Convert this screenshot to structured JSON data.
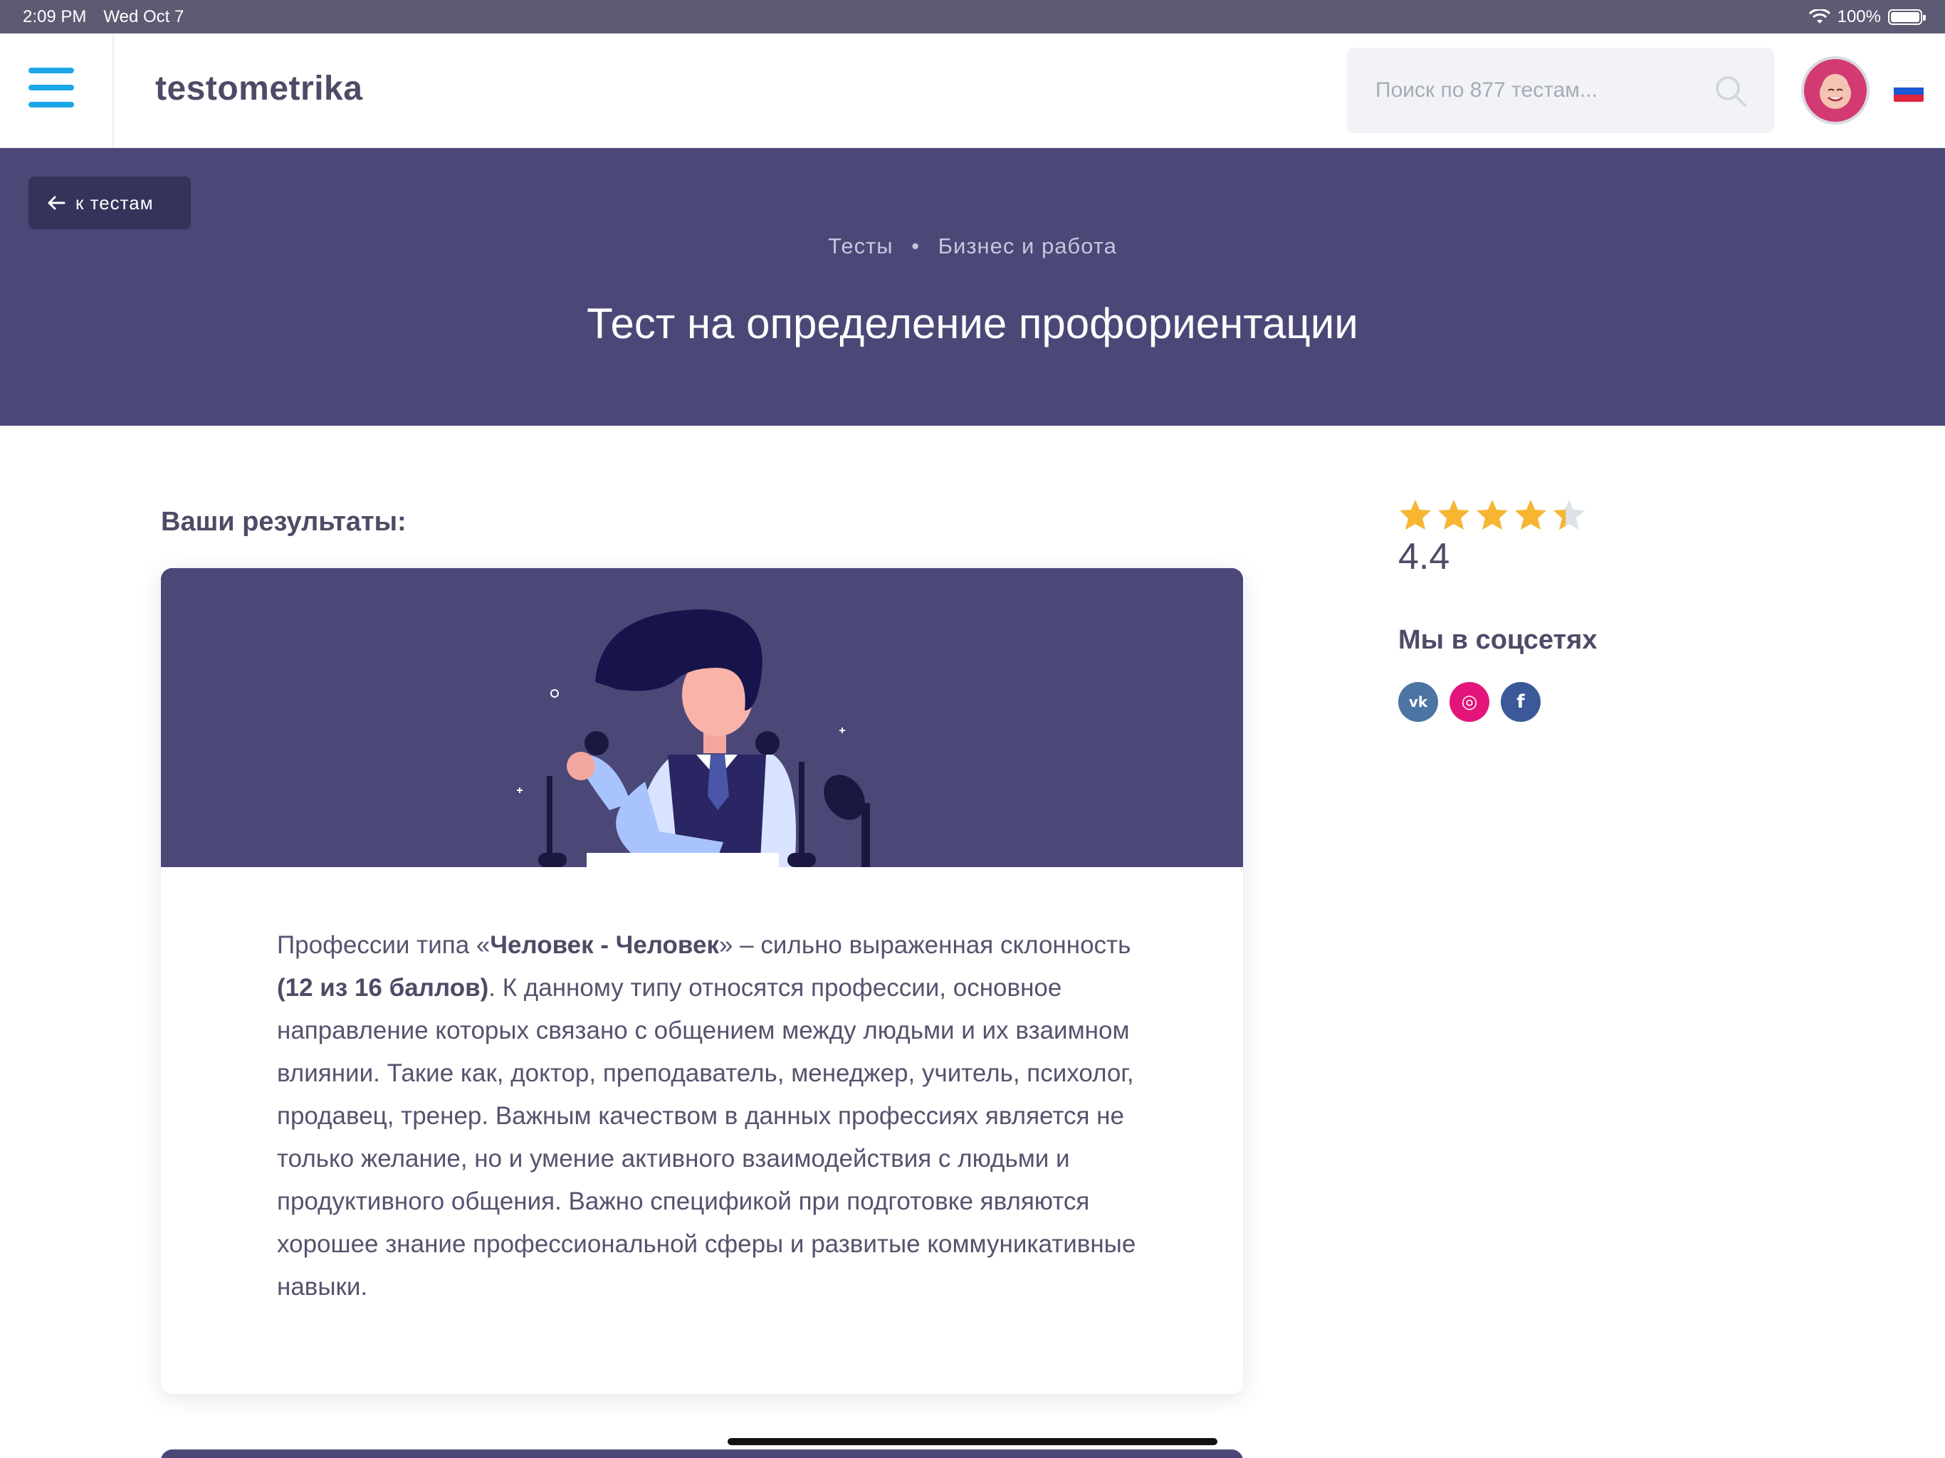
{
  "status_bar": {
    "time": "2:09 PM",
    "date": "Wed Oct 7",
    "battery": "100%"
  },
  "header": {
    "logo": "testometrika",
    "search_placeholder": "Поиск по 877 тестам..."
  },
  "hero": {
    "back_label": "к тестам",
    "breadcrumb": [
      "Тесты",
      "Бизнес и работа"
    ],
    "breadcrumb_separator": "•",
    "title": "Тест на определение профориентации"
  },
  "results": {
    "heading": "Ваши результаты:",
    "text_parts": [
      "Профессии типа «",
      "Человек - Человек",
      "» – сильно выраженная склонность ",
      "(12 из 16 баллов)",
      ". К данному типу относятся профессии, основное направление которых связано с общением между людьми и их взаимном влиянии. Такие как, доктор, преподаватель, менеджер, учитель, психолог, продавец, тренер. Важным качеством в данных профессиях является не только желание, но и умение активного взаимодействия с людьми и продуктивного общения. Важно спецификой при подготовке являются хорошее знание профессиональной сферы и развитые коммуникативные навыки."
    ]
  },
  "sidebar": {
    "rating": "4.4",
    "rating_fraction": 0.88,
    "social_heading": "Мы в соцсетях",
    "social": [
      {
        "name": "vk",
        "icon": "vk-icon",
        "glyph": "vk",
        "color": "#4c75a3"
      },
      {
        "name": "instagram",
        "icon": "instagram-icon",
        "glyph": "◎",
        "color": "#e4157a"
      },
      {
        "name": "facebook",
        "icon": "facebook-icon",
        "glyph": "f",
        "color": "#3b5998"
      }
    ]
  },
  "colors": {
    "accent": "#1ea7e8",
    "hero": "#4b4878",
    "star": "#f7b532",
    "star_empty": "#dde1e8"
  }
}
